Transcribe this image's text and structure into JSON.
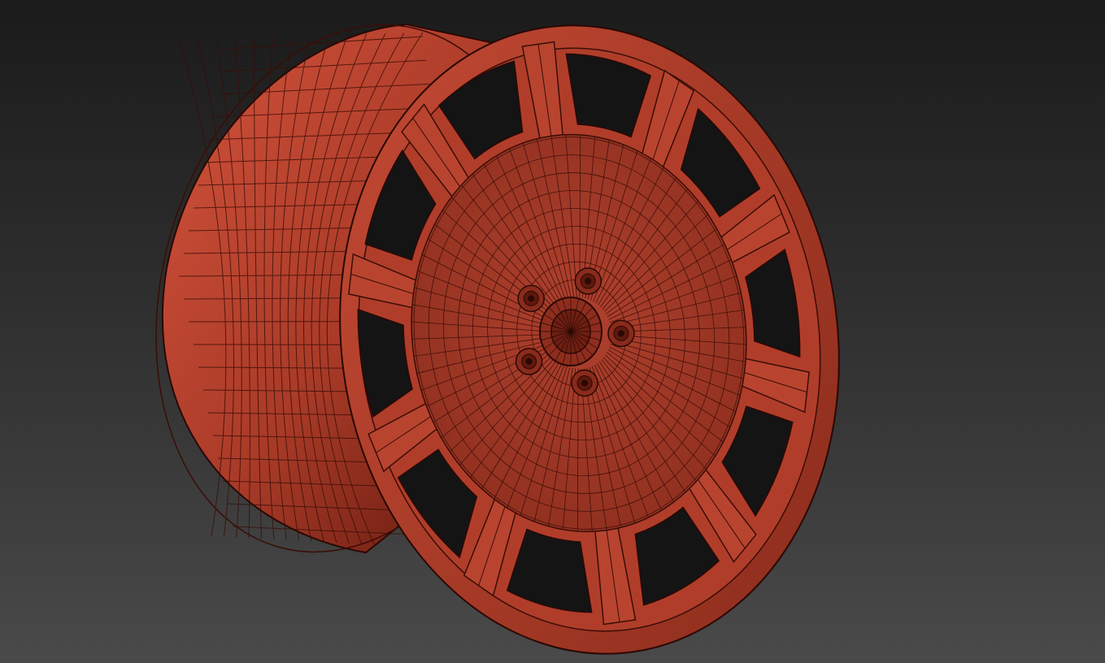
{
  "viewport": {
    "label": "",
    "background_top": "#1b1b1b",
    "background_bottom": "#4a4a4a"
  },
  "model": {
    "name": "wheel-rim",
    "display_mode": "shaded-with-wireframe",
    "base_color": "#b5412e",
    "wire_color": "#3a0d06",
    "spoke_count": 10,
    "lug_nut_count": 5
  }
}
